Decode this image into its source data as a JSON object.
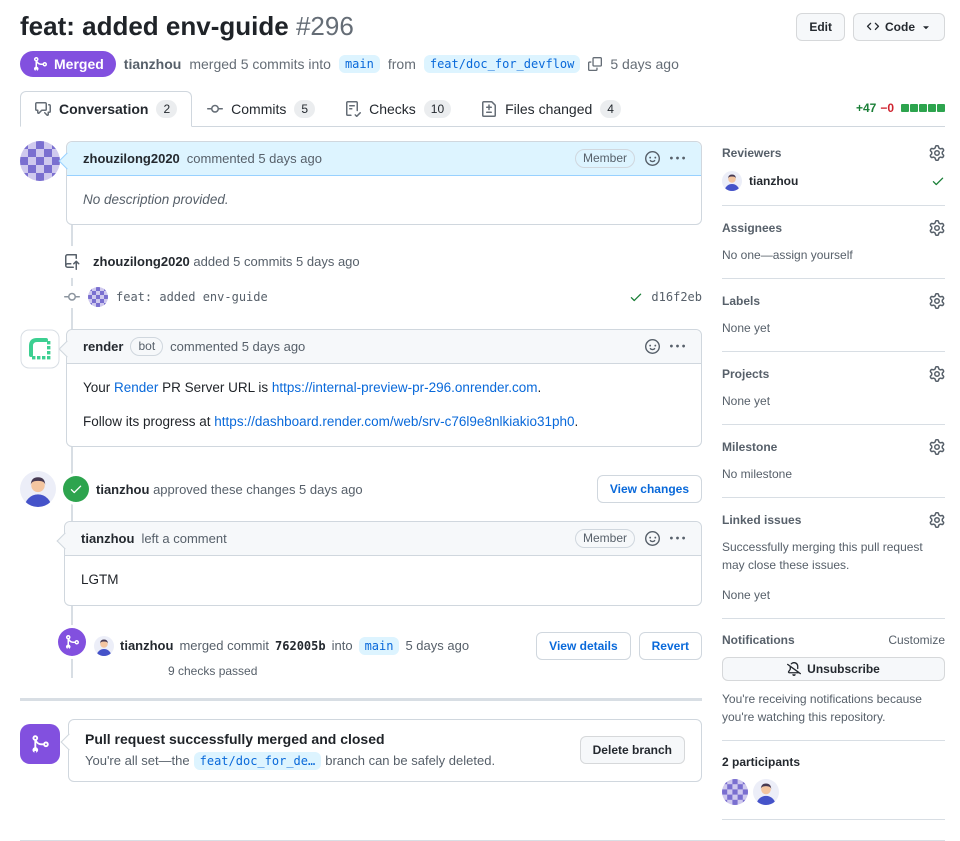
{
  "colors": {
    "merged_purple": "#8250df",
    "link_blue": "#0969da",
    "success_green": "#1a7f37",
    "diff_block_green": "#2da44e",
    "danger_red": "#cf222e",
    "branch_pill_bg": "#ddf4ff",
    "render_green": "#3ccf91"
  },
  "header": {
    "title": "feat: added env-guide",
    "number": "#296",
    "edit_button": "Edit",
    "code_button": "Code",
    "status_badge": "Merged",
    "author": "tianzhou",
    "merge_action": "merged 5 commits into",
    "base_branch": "main",
    "from_word": "from",
    "head_branch": "feat/doc_for_devflow",
    "time": "5 days ago"
  },
  "tabs": [
    {
      "label": "Conversation",
      "count": "2"
    },
    {
      "label": "Commits",
      "count": "5"
    },
    {
      "label": "Checks",
      "count": "10"
    },
    {
      "label": "Files changed",
      "count": "4"
    }
  ],
  "diffstat": {
    "additions": "+47",
    "deletions": "−0"
  },
  "timeline": {
    "comment1": {
      "author": "zhouzilong2020",
      "meta": "commented 5 days ago",
      "member_badge": "Member",
      "body": "No description provided."
    },
    "commits_event": {
      "author": "zhouzilong2020",
      "meta": "added 5 commits 5 days ago"
    },
    "commit_row": {
      "message": "feat: added env-guide",
      "sha": "d16f2eb"
    },
    "bot_comment": {
      "author": "render",
      "bot_badge": "bot",
      "meta": "commented 5 days ago",
      "p1_pre": "Your ",
      "p1_link1": "Render",
      "p1_mid": " PR Server URL is ",
      "p1_link2": "https://internal-preview-pr-296.onrender.com",
      "p1_end": ".",
      "p2_pre": "Follow its progress at ",
      "p2_link": "https://dashboard.render.com/web/srv-c76l9e8nlkiakio31ph0",
      "p2_end": "."
    },
    "review_event": {
      "author": "tianzhou",
      "meta": "approved these changes 5 days ago",
      "button": "View changes"
    },
    "review_comment": {
      "author": "tianzhou",
      "meta": "left a comment",
      "member_badge": "Member",
      "body": "LGTM"
    },
    "merge_event": {
      "author": "tianzhou",
      "pre": "merged commit",
      "sha": "762005b",
      "mid": "into",
      "branch": "main",
      "time": "5 days ago",
      "checks": "9 checks passed",
      "view_details_button": "View details",
      "revert_button": "Revert"
    },
    "merged_box": {
      "title": "Pull request successfully merged and closed",
      "body_pre": "You're all set—the",
      "branch": "feat/doc_for_de…",
      "body_post": "branch can be safely deleted.",
      "delete_button": "Delete branch"
    }
  },
  "sidebar": {
    "reviewers": {
      "heading": "Reviewers",
      "name": "tianzhou"
    },
    "assignees": {
      "heading": "Assignees",
      "empty": "No one—assign yourself"
    },
    "labels": {
      "heading": "Labels",
      "empty": "None yet"
    },
    "projects": {
      "heading": "Projects",
      "empty": "None yet"
    },
    "milestone": {
      "heading": "Milestone",
      "empty": "No milestone"
    },
    "linked_issues": {
      "heading": "Linked issues",
      "note": "Successfully merging this pull request may close these issues.",
      "empty": "None yet"
    },
    "notifications": {
      "heading": "Notifications",
      "customize": "Customize",
      "button": "Unsubscribe",
      "note": "You're receiving notifications because you're watching this repository."
    },
    "participants": {
      "heading": "2 participants"
    }
  }
}
